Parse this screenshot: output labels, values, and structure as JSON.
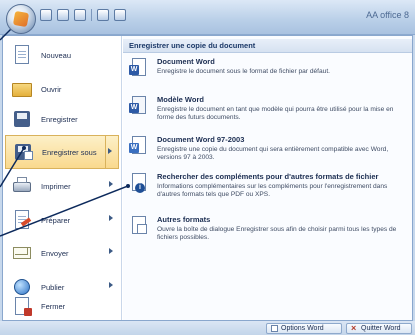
{
  "app": {
    "title": "AA office 8"
  },
  "quick_access": [
    "save",
    "undo",
    "redo",
    "print",
    "preview"
  ],
  "menu_left": [
    {
      "label": "Nouveau",
      "icon": "new-document-icon",
      "has_submenu": false
    },
    {
      "label": "Ouvrir",
      "icon": "open-folder-icon",
      "has_submenu": false
    },
    {
      "label": "Enregistrer",
      "icon": "save-disk-icon",
      "has_submenu": false
    },
    {
      "label": "Enregistrer sous",
      "icon": "save-as-icon",
      "has_submenu": true,
      "selected": true
    },
    {
      "label": "Imprimer",
      "icon": "printer-icon",
      "has_submenu": true
    },
    {
      "label": "Préparer",
      "icon": "prepare-icon",
      "has_submenu": true
    },
    {
      "label": "Envoyer",
      "icon": "send-mail-icon",
      "has_submenu": true
    },
    {
      "label": "Publier",
      "icon": "publish-globe-icon",
      "has_submenu": true
    },
    {
      "label": "Fermer",
      "icon": "close-document-icon",
      "has_submenu": false
    }
  ],
  "menu_right": {
    "heading": "Enregistrer une copie du document",
    "options": [
      {
        "title": "Document Word",
        "desc": "Enregistre le document sous le format de fichier par défaut.",
        "icon": "word-document-icon"
      },
      {
        "title": "Modèle Word",
        "desc": "Enregistre le document en tant que modèle qui pourra être utilisé pour la mise en forme des futurs documents.",
        "icon": "word-template-icon"
      },
      {
        "title": "Document Word 97-2003",
        "desc": "Enregistre une copie du document qui sera entièrement compatible avec Word, versions 97 à 2003.",
        "icon": "word-97-2003-icon"
      },
      {
        "title": "Rechercher des compléments pour d'autres formats de fichier",
        "desc": "Informations complémentaires sur les compléments pour l'enregistrement dans d'autres formats tels que PDF ou XPS.",
        "icon": "addins-info-icon"
      },
      {
        "title": "Autres formats",
        "desc": "Ouvre la boîte de dialogue Enregistrer sous afin de choisir parmi tous les types de fichiers possibles.",
        "icon": "other-formats-icon"
      }
    ]
  },
  "footer": {
    "options_label": "Options Word",
    "quit_label": "Quitter Word"
  },
  "colors": {
    "selected_bg": "#f9d98e",
    "heading_text": "#1c3968",
    "frame_blue": "#8aa7cd"
  }
}
